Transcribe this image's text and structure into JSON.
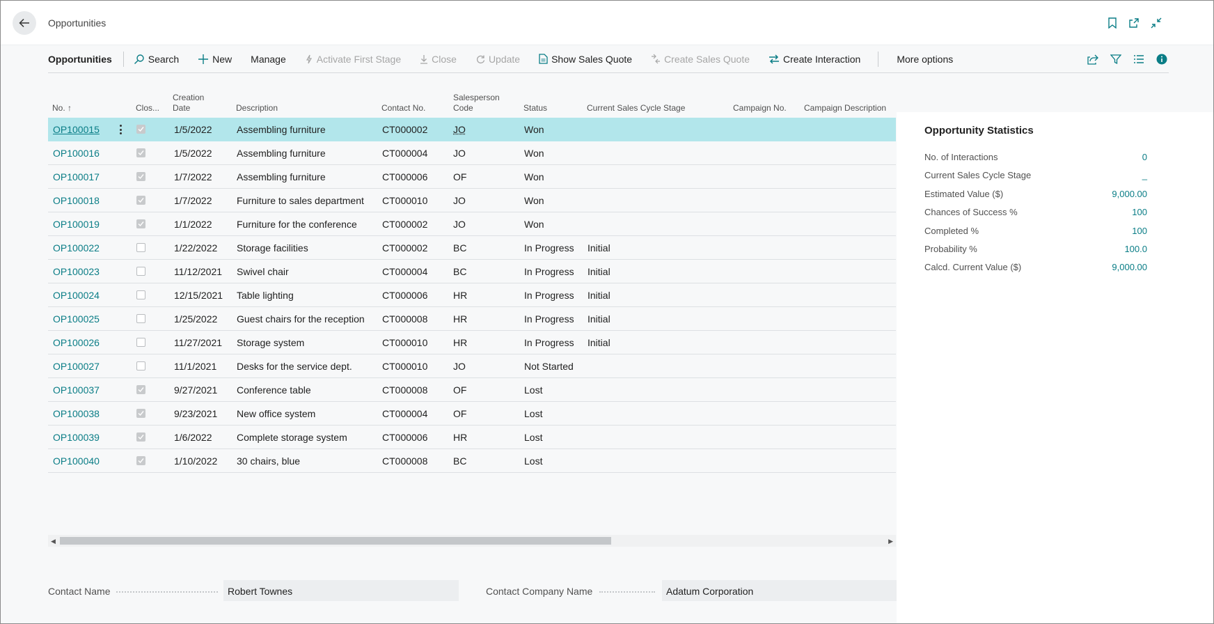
{
  "header": {
    "title": "Opportunities"
  },
  "actionbar": {
    "title": "Opportunities",
    "items": [
      {
        "label": "Search",
        "icon": "search-icon",
        "disabled": false
      },
      {
        "label": "New",
        "icon": "plus-icon",
        "disabled": false
      },
      {
        "label": "Manage",
        "icon": "",
        "disabled": false
      },
      {
        "label": "Activate First Stage",
        "icon": "lightning-icon",
        "disabled": true
      },
      {
        "label": "Close",
        "icon": "download-arrow-icon",
        "disabled": true
      },
      {
        "label": "Update",
        "icon": "refresh-icon",
        "disabled": true
      },
      {
        "label": "Show Sales Quote",
        "icon": "document-icon",
        "disabled": false
      },
      {
        "label": "Create Sales Quote",
        "icon": "transfer-icon",
        "disabled": true
      },
      {
        "label": "Create Interaction",
        "icon": "arrows-exchange-icon",
        "disabled": false
      }
    ],
    "more_options": "More options"
  },
  "table": {
    "columns": {
      "no": "No.",
      "closed": "Clos...",
      "creation_date_1": "Creation",
      "creation_date_2": "Date",
      "description": "Description",
      "contact_no": "Contact No.",
      "salesperson_1": "Salesperson",
      "salesperson_2": "Code",
      "status": "Status",
      "stage": "Current Sales Cycle Stage",
      "campaign_no": "Campaign No.",
      "campaign_desc": "Campaign Description"
    },
    "rows": [
      {
        "no": "OP100015",
        "closed": true,
        "date": "1/5/2022",
        "desc": "Assembling furniture",
        "contact": "CT000002",
        "sp": "JO",
        "status": "Won",
        "stage": ""
      },
      {
        "no": "OP100016",
        "closed": true,
        "date": "1/5/2022",
        "desc": "Assembling furniture",
        "contact": "CT000004",
        "sp": "JO",
        "status": "Won",
        "stage": ""
      },
      {
        "no": "OP100017",
        "closed": true,
        "date": "1/7/2022",
        "desc": "Assembling furniture",
        "contact": "CT000006",
        "sp": "OF",
        "status": "Won",
        "stage": ""
      },
      {
        "no": "OP100018",
        "closed": true,
        "date": "1/7/2022",
        "desc": "Furniture to sales department",
        "contact": "CT000010",
        "sp": "JO",
        "status": "Won",
        "stage": ""
      },
      {
        "no": "OP100019",
        "closed": true,
        "date": "1/1/2022",
        "desc": "Furniture for the conference",
        "contact": "CT000002",
        "sp": "JO",
        "status": "Won",
        "stage": ""
      },
      {
        "no": "OP100022",
        "closed": false,
        "date": "1/22/2022",
        "desc": "Storage facilities",
        "contact": "CT000002",
        "sp": "BC",
        "status": "In Progress",
        "stage": "Initial"
      },
      {
        "no": "OP100023",
        "closed": false,
        "date": "11/12/2021",
        "desc": "Swivel chair",
        "contact": "CT000004",
        "sp": "BC",
        "status": "In Progress",
        "stage": "Initial"
      },
      {
        "no": "OP100024",
        "closed": false,
        "date": "12/15/2021",
        "desc": "Table lighting",
        "contact": "CT000006",
        "sp": "HR",
        "status": "In Progress",
        "stage": "Initial"
      },
      {
        "no": "OP100025",
        "closed": false,
        "date": "1/25/2022",
        "desc": "Guest chairs for the reception",
        "contact": "CT000008",
        "sp": "HR",
        "status": "In Progress",
        "stage": "Initial"
      },
      {
        "no": "OP100026",
        "closed": false,
        "date": "11/27/2021",
        "desc": "Storage system",
        "contact": "CT000010",
        "sp": "HR",
        "status": "In Progress",
        "stage": "Initial"
      },
      {
        "no": "OP100027",
        "closed": false,
        "date": "11/1/2021",
        "desc": "Desks for the service dept.",
        "contact": "CT000010",
        "sp": "JO",
        "status": "Not Started",
        "stage": ""
      },
      {
        "no": "OP100037",
        "closed": true,
        "date": "9/27/2021",
        "desc": "Conference table",
        "contact": "CT000008",
        "sp": "OF",
        "status": "Lost",
        "stage": ""
      },
      {
        "no": "OP100038",
        "closed": true,
        "date": "9/23/2021",
        "desc": "New office system",
        "contact": "CT000004",
        "sp": "OF",
        "status": "Lost",
        "stage": ""
      },
      {
        "no": "OP100039",
        "closed": true,
        "date": "1/6/2022",
        "desc": "Complete storage system",
        "contact": "CT000006",
        "sp": "HR",
        "status": "Lost",
        "stage": ""
      },
      {
        "no": "OP100040",
        "closed": true,
        "date": "1/10/2022",
        "desc": "30 chairs, blue",
        "contact": "CT000008",
        "sp": "BC",
        "status": "Lost",
        "stage": ""
      }
    ],
    "selected_row": 0
  },
  "factbox": {
    "title": "Opportunity Statistics",
    "rows": [
      {
        "label": "No. of Interactions",
        "value": "0"
      },
      {
        "label": "Current Sales Cycle Stage",
        "value": "_"
      },
      {
        "label": "Estimated Value ($)",
        "value": "9,000.00"
      },
      {
        "label": "Chances of Success %",
        "value": "100"
      },
      {
        "label": "Completed %",
        "value": "100"
      },
      {
        "label": "Probability %",
        "value": "100.0"
      },
      {
        "label": "Calcd. Current Value ($)",
        "value": "9,000.00"
      }
    ]
  },
  "footer": {
    "contact_name_label": "Contact Name",
    "contact_name_value": "Robert Townes",
    "company_name_label": "Contact Company Name",
    "company_name_value": "Adatum Corporation"
  },
  "colors": {
    "accent": "#0a7d86",
    "selected_row": "#b2e6eb"
  }
}
